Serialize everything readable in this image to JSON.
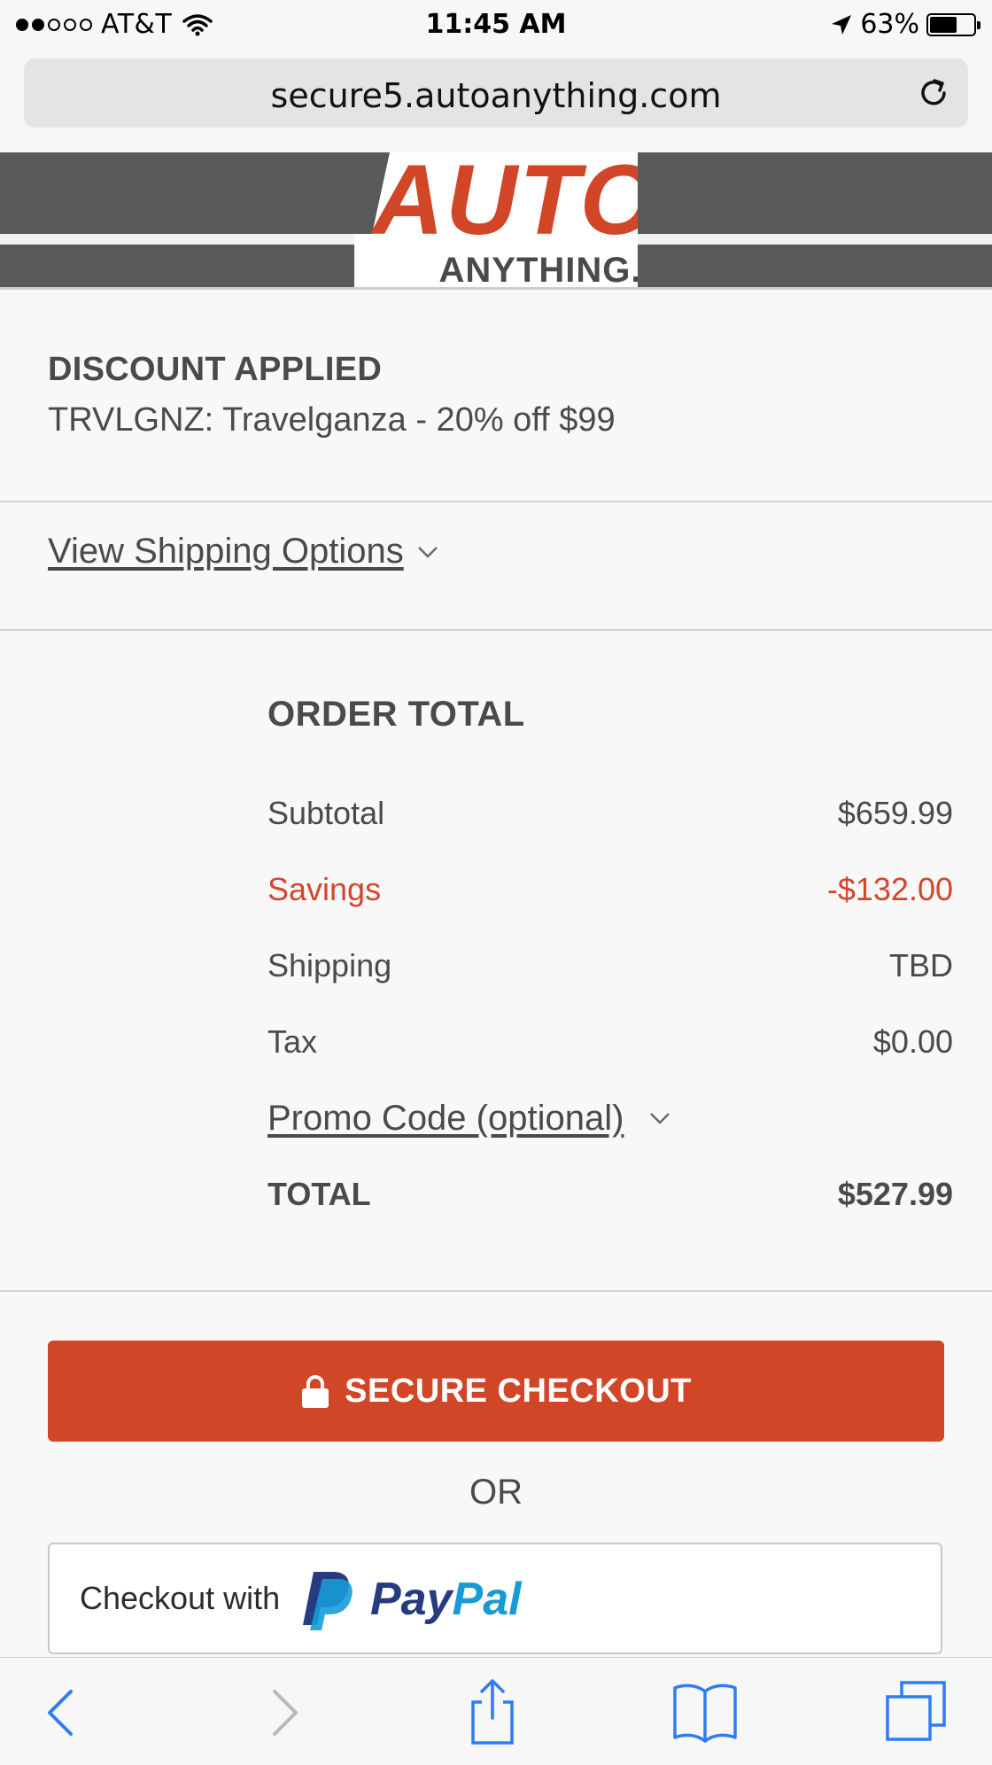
{
  "status_bar": {
    "carrier": "AT&T",
    "time": "11:45 AM",
    "battery_percent": "63%",
    "signal_bars_filled": 2,
    "signal_bars_total": 5,
    "battery_level": 0.63
  },
  "browser": {
    "url": "secure5.autoanything.com"
  },
  "header": {
    "logo_top": "AUTO",
    "logo_bottom": "ANYTHING."
  },
  "discount": {
    "title": "DISCOUNT APPLIED",
    "description": "TRVLGNZ: Travelganza - 20% off $99"
  },
  "shipping": {
    "link_label": "View Shipping Options"
  },
  "order_total": {
    "title": "ORDER TOTAL",
    "rows": [
      {
        "label": "Subtotal",
        "value": "$659.99"
      },
      {
        "label": "Savings",
        "value": "-$132.00"
      },
      {
        "label": "Shipping",
        "value": "TBD"
      },
      {
        "label": "Tax",
        "value": "$0.00"
      }
    ],
    "promo_label": "Promo Code (optional)",
    "total_label": "TOTAL",
    "total_value": "$527.99"
  },
  "checkout": {
    "button_label": "SECURE CHECKOUT",
    "or_label": "OR",
    "paypal_prefix": "Checkout with",
    "paypal_brand": "PayPal"
  },
  "colors": {
    "accent": "#d24628",
    "savings": "#d4462a",
    "header_gray": "#58595b",
    "ios_blue": "#2f7cf6"
  }
}
